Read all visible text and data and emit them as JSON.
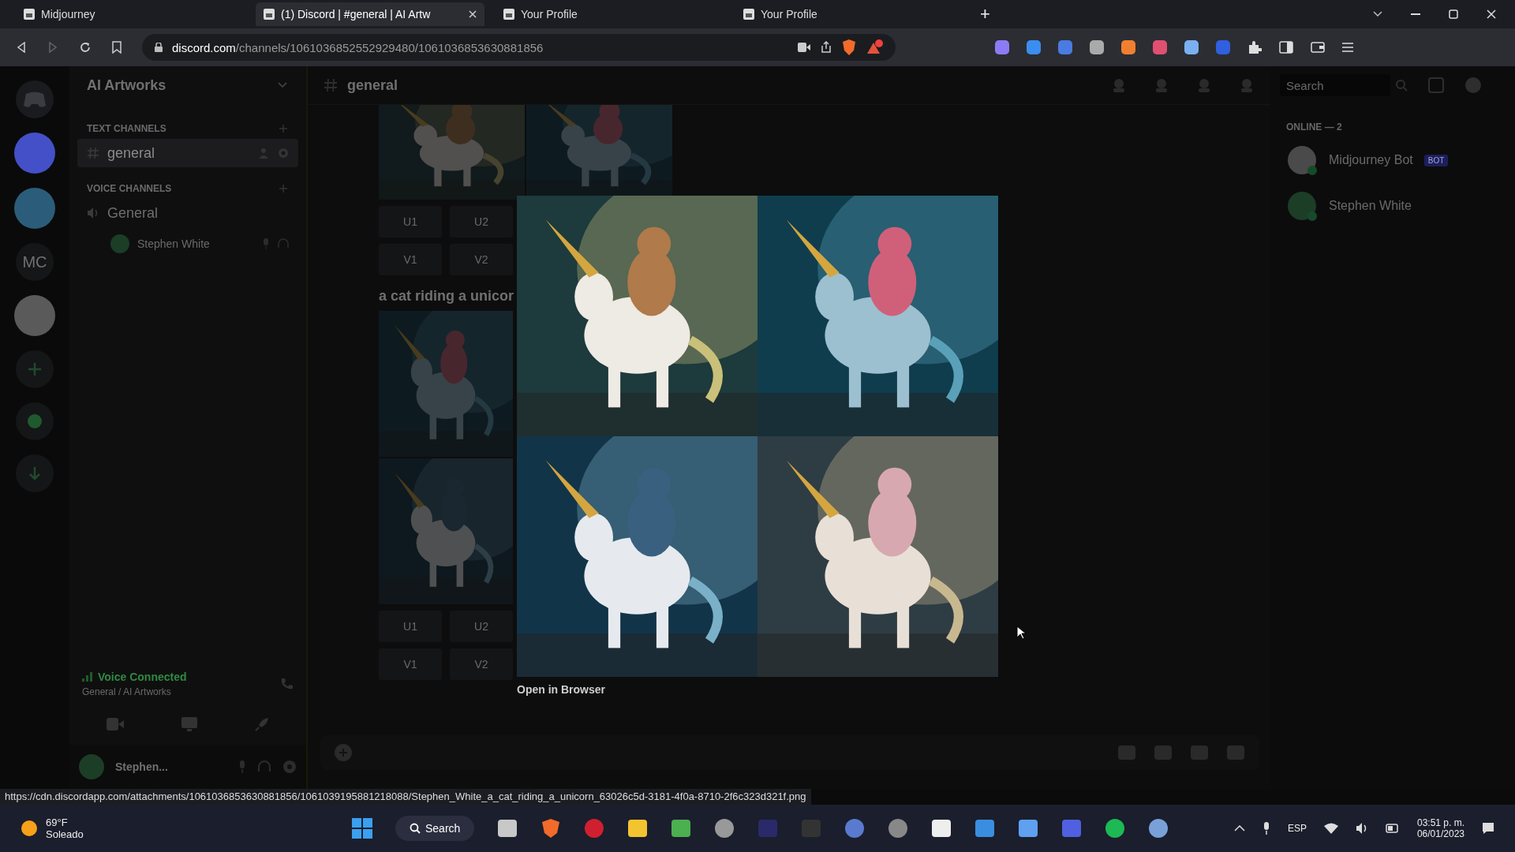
{
  "browser": {
    "tabs": [
      {
        "title": "Midjourney",
        "selected": false
      },
      {
        "title": "(1) Discord | #general | AI Artw",
        "selected": true
      },
      {
        "title": "Your Profile",
        "selected": false
      },
      {
        "title": "Your Profile",
        "selected": false
      }
    ],
    "new_tab": "+",
    "address": {
      "host": "discord.com",
      "path": "/channels/1061036852552929480/1061036853630881856"
    }
  },
  "discord": {
    "rail": [
      {
        "kind": "home"
      },
      {
        "kind": "avatar",
        "color": "#4450c8"
      },
      {
        "kind": "avatar",
        "color": "#2b5d7a"
      },
      {
        "kind": "text",
        "label": "MC"
      },
      {
        "kind": "avatar",
        "color": "#5a5a5a"
      },
      {
        "kind": "add"
      },
      {
        "kind": "explore"
      },
      {
        "kind": "download"
      }
    ],
    "server": {
      "name": "AI Artworks",
      "categories": [
        {
          "name": "TEXT CHANNELS",
          "kind": "text",
          "channels": [
            {
              "name": "general",
              "selected": true
            }
          ]
        },
        {
          "name": "VOICE CHANNELS",
          "kind": "voice",
          "channels": [
            {
              "name": "General",
              "selected": false,
              "members": [
                "Stephen White"
              ]
            }
          ]
        }
      ]
    },
    "voice": {
      "status": "Voice Connected",
      "location": "General / AI Artworks"
    },
    "user": {
      "name": "Stephen..."
    },
    "chat": {
      "channel": "general",
      "search": {
        "placeholder": "Search"
      },
      "messages": [
        {
          "buttons": [
            [
              "U1",
              "U2"
            ],
            [
              "V1",
              "V2"
            ]
          ]
        },
        {
          "caption": "a cat riding a unicor",
          "buttons": [
            [
              "U1",
              "U2"
            ],
            [
              "V1",
              "V2"
            ]
          ]
        }
      ]
    },
    "members": {
      "heading": "ONLINE — 2",
      "items": [
        {
          "name": "Midjourney Bot",
          "badge": "BOT"
        },
        {
          "name": "Stephen White"
        }
      ]
    }
  },
  "lightbox": {
    "link": "Open in Browser"
  },
  "status_url": "https://cdn.discordapp.com/attachments/1061036853630881856/1061039195881218088/Stephen_White_a_cat_riding_a_unicorn_63026c5d-3181-4f0a-8710-2f6c323d321f.png",
  "taskbar": {
    "weather": {
      "temperature": "69°F",
      "condition": "Soleado"
    },
    "search": "Search",
    "language": "ESP",
    "time": "03:51 p. m.",
    "date": "06/01/2023"
  }
}
